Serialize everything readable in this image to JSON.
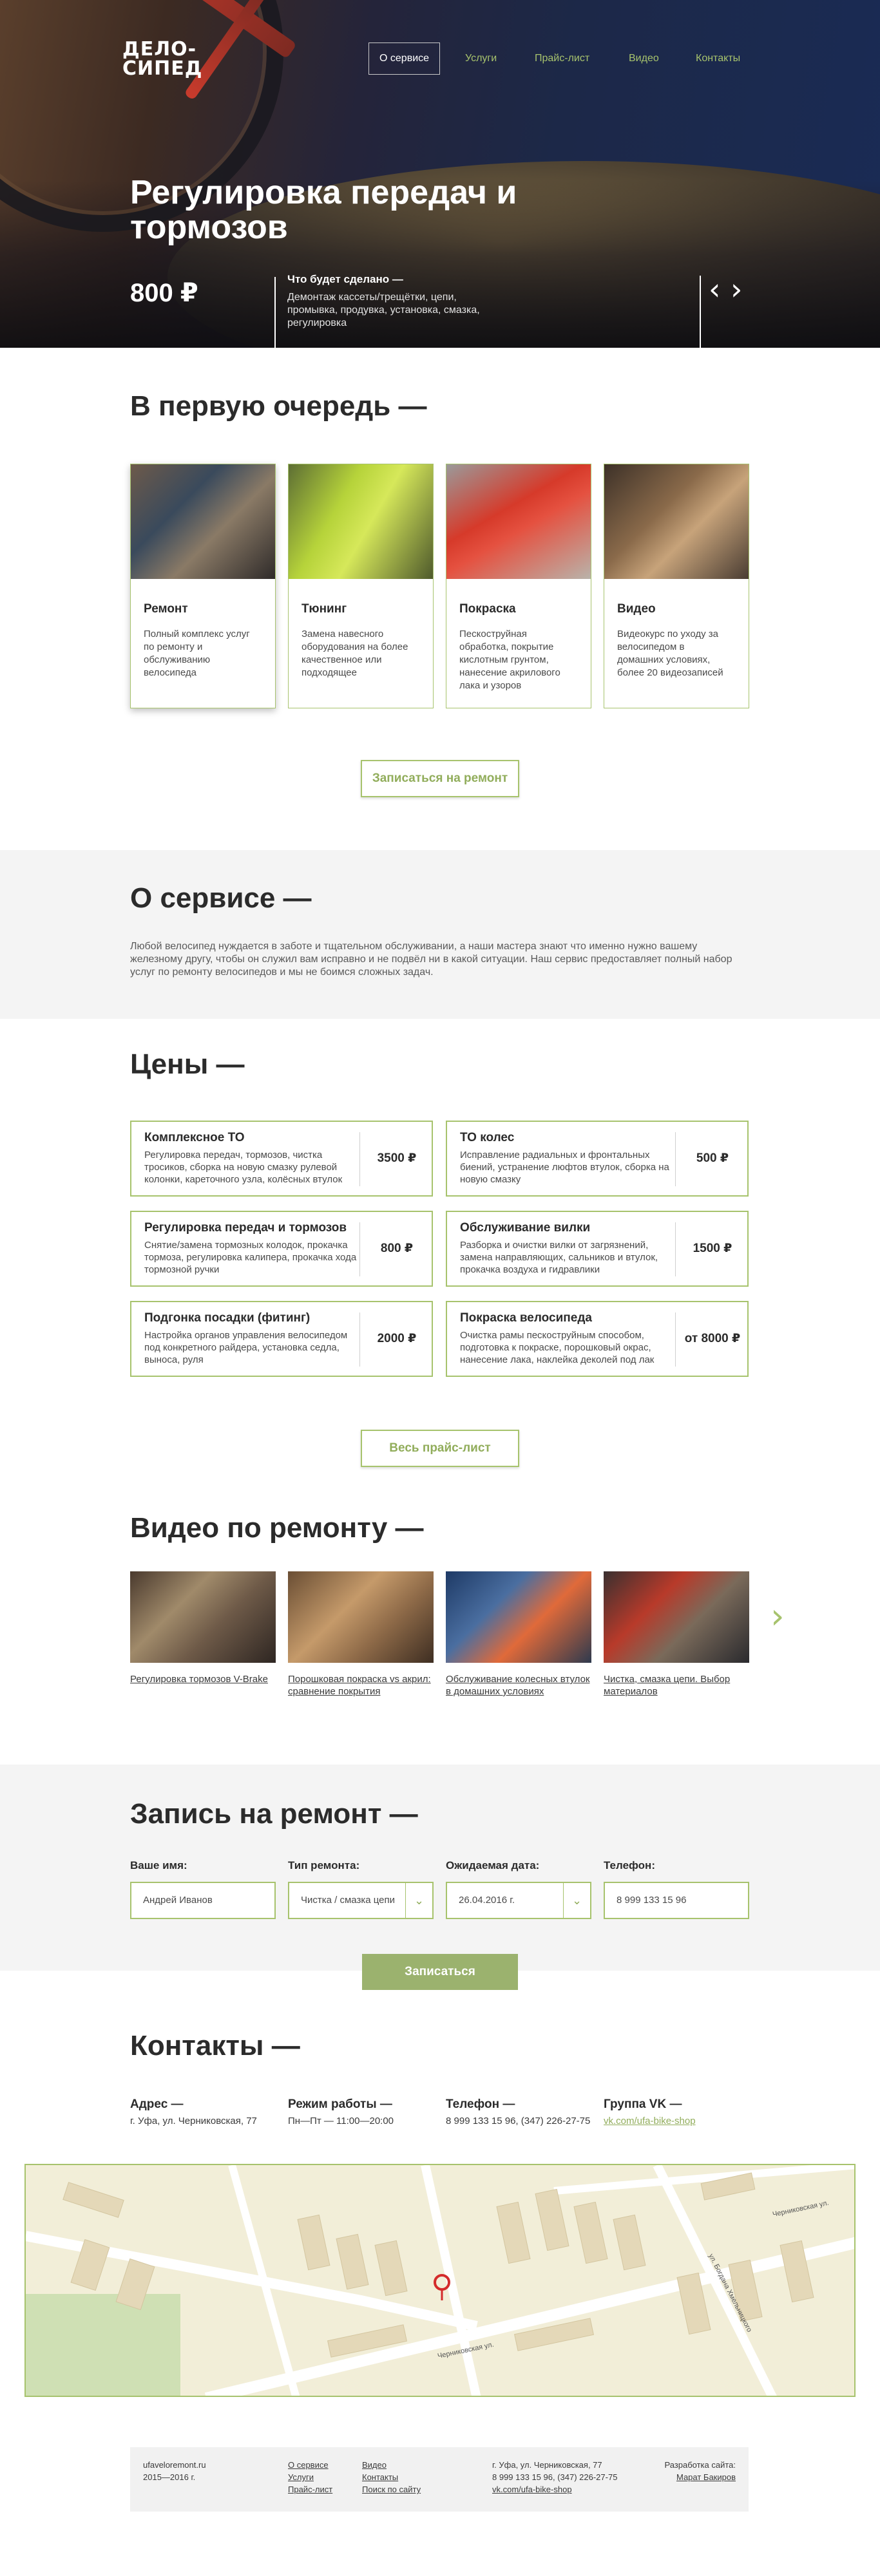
{
  "logo": {
    "line1": "ДЕЛО-",
    "line2": "СИПЕД"
  },
  "nav": [
    {
      "label": "О сервисе",
      "active": true
    },
    {
      "label": "Услуги"
    },
    {
      "label": "Прайс-лист"
    },
    {
      "label": "Видео"
    },
    {
      "label": "Контакты"
    }
  ],
  "hero": {
    "title": "Регулировка передач и тормозов",
    "price": "800 ₽",
    "done_title": "Что будет сделано —",
    "done_text": "Демонтаж кассеты/трещётки, цепи, промывка, продувка, установка, смазка, регулировка",
    "prev_icon": "chevron-left-icon",
    "next_icon": "chevron-right-icon"
  },
  "first": {
    "heading": "В первую очередь —",
    "cards": [
      {
        "title": "Ремонт",
        "text": "Полный комплекс услуг по ремонту и обслуживанию велосипеда"
      },
      {
        "title": "Тюнинг",
        "text": "Замена навесного оборудования на более качественное или подходящее"
      },
      {
        "title": "Покраска",
        "text": "Пескоструйная обработка, покрытие кислотным грунтом, нанесение акрилового лака и узоров"
      },
      {
        "title": "Видео",
        "text": "Видеокурс по уходу за велосипедом в домашних условиях, более 20 видеозаписей"
      }
    ],
    "button": "Записаться на ремонт"
  },
  "about": {
    "heading": "О сервисе —",
    "text": "Любой велосипед нуждается в заботе и тщательном обслуживании, а наши мастера знают что именно нужно вашему железному другу, чтобы он служил вам исправно и не подвёл ни в какой ситуации. Наш сервис предоставляет полный набор услуг по ремонту велосипедов и мы не боимся сложных задач."
  },
  "prices": {
    "heading": "Цены —",
    "items": [
      {
        "title": "Комплексное ТО",
        "text": "Регулировка передач, тормозов, чистка тросиков, сборка на новую смазку рулевой колонки, кареточного узла, колёсных втулок",
        "price": "3500 ₽"
      },
      {
        "title": "ТО колес",
        "text": "Исправление радиальных и фронтальных биений, устранение люфтов втулок, сборка на новую смазку",
        "price": "500 ₽"
      },
      {
        "title": "Регулировка передач и тормозов",
        "text": "Снятие/замена тормозных колодок, прокачка тормоза, регулировка калипера, прокачка хода тормозной ручки",
        "price": "800 ₽"
      },
      {
        "title": "Обслуживание вилки",
        "text": "Разборка и очистки вилки от загрязнений, замена направляющих, сальников и втулок, прокачка воздуха и гидравлики",
        "price": "1500 ₽"
      },
      {
        "title": "Подгонка посадки (фитинг)",
        "text": "Настройка органов управления велосипедом под конкретного райдера, установка седла, выноса, руля",
        "price": "2000 ₽"
      },
      {
        "title": "Покраска велосипеда",
        "text": "Очистка рамы пескоструйным способом, подготовка к покраске, порошковый окрас, нанесение лака, наклейка деколей под лак",
        "price": "от 8000 ₽"
      }
    ],
    "button": "Весь прайс-лист"
  },
  "video": {
    "heading": "Видео по ремонту —",
    "items": [
      {
        "caption": "Регулировка тормозов V-Brake"
      },
      {
        "caption": "Порошковая покраска vs акрил: сравнение покрытия"
      },
      {
        "caption": "Обслуживание колесных втулок в домашних условиях"
      },
      {
        "caption": "Чистка, смазка цепи. Выбор материалов"
      }
    ],
    "next_icon": "chevron-right-icon"
  },
  "form": {
    "heading": "Запись на ремонт —",
    "name_label": "Ваше имя:",
    "name_value": "Андрей Иванов",
    "type_label": "Тип ремонта:",
    "type_value": "Чистка / смазка цепи",
    "date_label": "Ожидаемая дата:",
    "date_value": "26.04.2016 г.",
    "phone_label": "Телефон:",
    "phone_value": "8 999 133 15 96",
    "submit": "Записаться"
  },
  "contacts": {
    "heading": "Контакты —",
    "address_label": "Адрес —",
    "address": "г. Уфа, ул. Черниковская, 77",
    "hours_label": "Режим работы —",
    "hours": "Пн—Пт — 11:00—20:00",
    "phone_label": "Телефон —",
    "phone": "8 999 133 15 96, (347) 226-27-75",
    "vk_label": "Группа VK —",
    "vk": "vk.com/ufa-bike-shop"
  },
  "map": {
    "street1": "Черниковская ул.",
    "street2": "ул. Богдана Хмельницкого",
    "street3": "Черниковская ул.",
    "marker_icon": "map-pin-icon"
  },
  "footer": {
    "site": "ufaveloremont.ru",
    "years": "2015—2016 г.",
    "links1": [
      "О сервисе",
      "Услуги",
      "Прайс-лист"
    ],
    "links2": [
      "Видео",
      "Контакты",
      "Поиск по сайту"
    ],
    "address": "г. Уфа, ул. Черниковская, 77",
    "phones": "8 999 133 15 96, (347) 226-27-75",
    "vk": "vk.com/ufa-bike-shop",
    "dev_label": "Разработка сайта:",
    "dev_name": "Марат Бакиров"
  }
}
